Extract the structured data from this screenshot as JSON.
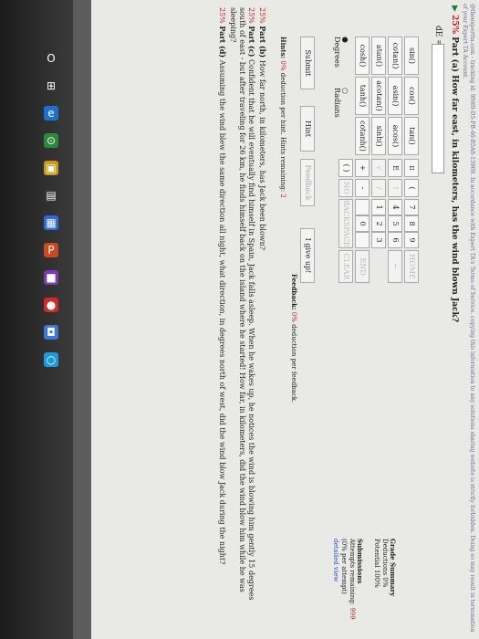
{
  "notice": "@theexpertta.com - tracking id: 9N69-D5-FB-46-B5A8-13908. In accordance with Expert TA's Terms of Service. copying this information to any solutions sharing website is strictly forbidden. Doing so may result in termination of your Expert TA Account.",
  "part_a": {
    "percent": "25%",
    "label": "Part (a)",
    "question": "How far east, in kilometers, has the wind blown Jack?",
    "answer_label": "dE ="
  },
  "calculator": {
    "functions": [
      [
        "sin()",
        "cos()",
        "tan()"
      ],
      [
        "cotan()",
        "asin()",
        "acos()"
      ],
      [
        "atan()",
        "acotan()",
        "sinh()"
      ],
      [
        "cosh()",
        "tanh()",
        "cotanh()"
      ]
    ],
    "symbols": [
      "π",
      "E",
      "√",
      "+",
      "( )"
    ],
    "operators": [
      "(",
      "↑",
      "/",
      "-",
      "NO"
    ],
    "digits": [
      [
        "7",
        "8",
        "9"
      ],
      [
        "4",
        "5",
        "6"
      ],
      [
        "1",
        "2",
        "3"
      ],
      [
        "",
        "0",
        ""
      ]
    ],
    "right_keys": [
      "HOME",
      "←",
      "END",
      "CLEAR"
    ],
    "bottom_key": "BACKSPACE",
    "degrees": "Degrees",
    "radians": "Radians"
  },
  "buttons": {
    "submit": "Submit",
    "hint": "Hint",
    "feedback": "Feedback",
    "give_up": "I give up!"
  },
  "hints_text": {
    "prefix": "Hints:",
    "pct": "0%",
    "suffix": "deduction per hint. Hints remaining:",
    "remaining": "2"
  },
  "feedback_text": {
    "prefix": "Feedback:",
    "pct": "0%",
    "suffix": "deduction per feedback."
  },
  "parts": [
    {
      "percent": "25%",
      "label": "Part (b)",
      "text": "How far north, in kilometers, has Jack been blown?"
    },
    {
      "percent": "25%",
      "label": "Part (c)",
      "text": "Confident that he will eventually find himself in Spain, Jack falls asleep. When he wakes up, he notices the wind is blowing him gently 15 degrees south of east - but after traveling for 26 km, he finds himself back on the island where he started! How far, in kilometers, did the wind blow him while he was sleeping?"
    },
    {
      "percent": "25%",
      "label": "Part (d)",
      "text": "Assuming the wind blew the same direction all night, what direction, in degrees north of west, did the wind blow Jack during the night?"
    }
  ],
  "grade": {
    "title": "Grade Summary",
    "deductions": "Deductions",
    "deductions_val": "0%",
    "potential": "Potential",
    "potential_val": "100%",
    "submissions": "Submissions",
    "attempts": "Attempts remaining:",
    "attempts_val": "999",
    "per_attempt": "(0% per attempt)",
    "detailed": "detailed view"
  },
  "taskbar": [
    "O",
    "⊞",
    "e",
    "⊙",
    "▣",
    "▤",
    "▦",
    "P",
    "■",
    "●",
    "◘",
    "○"
  ]
}
